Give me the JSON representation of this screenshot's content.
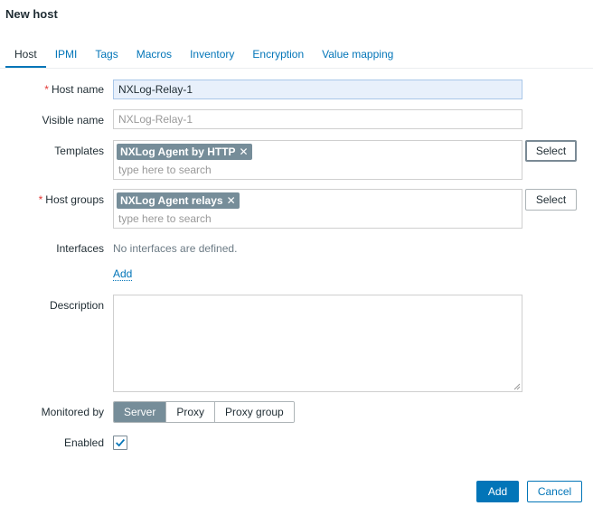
{
  "page": {
    "title": "New host"
  },
  "tabs": [
    {
      "label": "Host"
    },
    {
      "label": "IPMI"
    },
    {
      "label": "Tags"
    },
    {
      "label": "Macros"
    },
    {
      "label": "Inventory"
    },
    {
      "label": "Encryption"
    },
    {
      "label": "Value mapping"
    }
  ],
  "form": {
    "host_name": {
      "label": "Host name",
      "required_mark": "*",
      "value": "NXLog-Relay-1"
    },
    "visible_name": {
      "label": "Visible name",
      "placeholder": "NXLog-Relay-1"
    },
    "templates": {
      "label": "Templates",
      "chip": "NXLog Agent by HTTP",
      "placeholder": "type here to search",
      "select_label": "Select"
    },
    "host_groups": {
      "label": "Host groups",
      "required_mark": "*",
      "chip": "NXLog Agent relays",
      "placeholder": "type here to search",
      "select_label": "Select"
    },
    "interfaces": {
      "label": "Interfaces",
      "message": "No interfaces are defined.",
      "add_label": "Add"
    },
    "description": {
      "label": "Description",
      "value": ""
    },
    "monitored_by": {
      "label": "Monitored by",
      "options": [
        "Server",
        "Proxy",
        "Proxy group"
      ],
      "selected": "Server"
    },
    "enabled": {
      "label": "Enabled",
      "checked": true
    }
  },
  "footer": {
    "add_label": "Add",
    "cancel_label": "Cancel"
  },
  "colors": {
    "accent": "#0275b8",
    "chip": "#768d99",
    "required": "#e33734",
    "focused_input": "#e8f0fb"
  },
  "icons": {
    "chip_remove": "close-icon",
    "checkbox": "checkmark-icon"
  }
}
